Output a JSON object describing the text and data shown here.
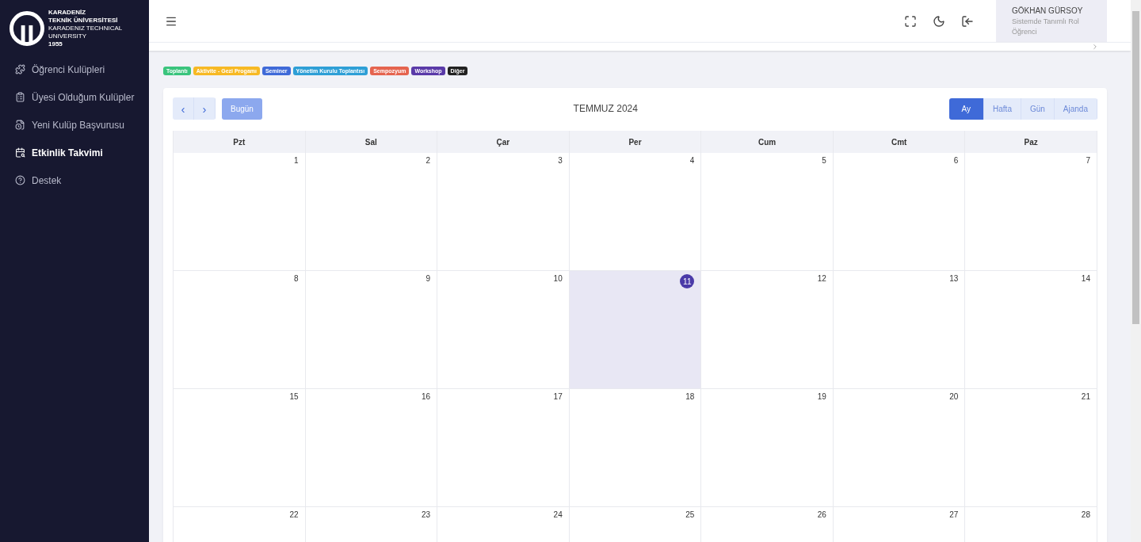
{
  "logo": {
    "lines": [
      "KARADENİZ",
      "TEKNİK ÜNİVERSİTESİ",
      "KARADENIZ TECHNICAL UNIVERSITY",
      "1955"
    ]
  },
  "sidebar": {
    "items": [
      {
        "label": "Öğrenci Kulüpleri",
        "selected": false
      },
      {
        "label": "Üyesi Olduğum Kulüpler",
        "selected": false
      },
      {
        "label": "Yeni Kulüp Başvurusu",
        "selected": false
      },
      {
        "label": "Etkinlik Takvimi",
        "selected": true
      },
      {
        "label": "Destek",
        "selected": false
      }
    ]
  },
  "user": {
    "name": "GÖKHAN GÜRSOY",
    "role": "Sistemde Tanımlı Rol",
    "role_value": "Öğrenci"
  },
  "legend": [
    {
      "label": "Toplantı",
      "color": "#3ac47d"
    },
    {
      "label": "Aktivite - Gezi Progamı",
      "color": "#f7b924"
    },
    {
      "label": "Seminer",
      "color": "#3f6ad8"
    },
    {
      "label": "Yönetim Kurulu Toplantısı",
      "color": "#2e9fd6"
    },
    {
      "label": "Sempozyum",
      "color": "#e5644f"
    },
    {
      "label": "Workshop",
      "color": "#5a3aa8"
    },
    {
      "label": "Diğer",
      "color": "#222222"
    }
  ],
  "calendar": {
    "title": "TEMMUZ 2024",
    "prev": "‹",
    "next": "›",
    "today_button": "Bugün",
    "views": [
      {
        "label": "Ay",
        "selected": true
      },
      {
        "label": "Hafta",
        "selected": false
      },
      {
        "label": "Gün",
        "selected": false
      },
      {
        "label": "Ajanda",
        "selected": false
      }
    ],
    "weekdays": [
      "Pzt",
      "Sal",
      "Çar",
      "Per",
      "Cum",
      "Cmt",
      "Paz"
    ],
    "weeks": [
      [
        {
          "day": "1",
          "today": false
        },
        {
          "day": "2",
          "today": false
        },
        {
          "day": "3",
          "today": false
        },
        {
          "day": "4",
          "today": false
        },
        {
          "day": "5",
          "today": false
        },
        {
          "day": "6",
          "today": false
        },
        {
          "day": "7",
          "today": false
        }
      ],
      [
        {
          "day": "8",
          "today": false
        },
        {
          "day": "9",
          "today": false
        },
        {
          "day": "10",
          "today": false
        },
        {
          "day": "11",
          "today": true
        },
        {
          "day": "12",
          "today": false
        },
        {
          "day": "13",
          "today": false
        },
        {
          "day": "14",
          "today": false
        }
      ],
      [
        {
          "day": "15",
          "today": false
        },
        {
          "day": "16",
          "today": false
        },
        {
          "day": "17",
          "today": false
        },
        {
          "day": "18",
          "today": false
        },
        {
          "day": "19",
          "today": false
        },
        {
          "day": "20",
          "today": false
        },
        {
          "day": "21",
          "today": false
        }
      ],
      [
        {
          "day": "22",
          "today": false
        },
        {
          "day": "23",
          "today": false
        },
        {
          "day": "24",
          "today": false
        },
        {
          "day": "25",
          "today": false
        },
        {
          "day": "26",
          "today": false
        },
        {
          "day": "27",
          "today": false
        },
        {
          "day": "28",
          "today": false
        }
      ]
    ]
  }
}
